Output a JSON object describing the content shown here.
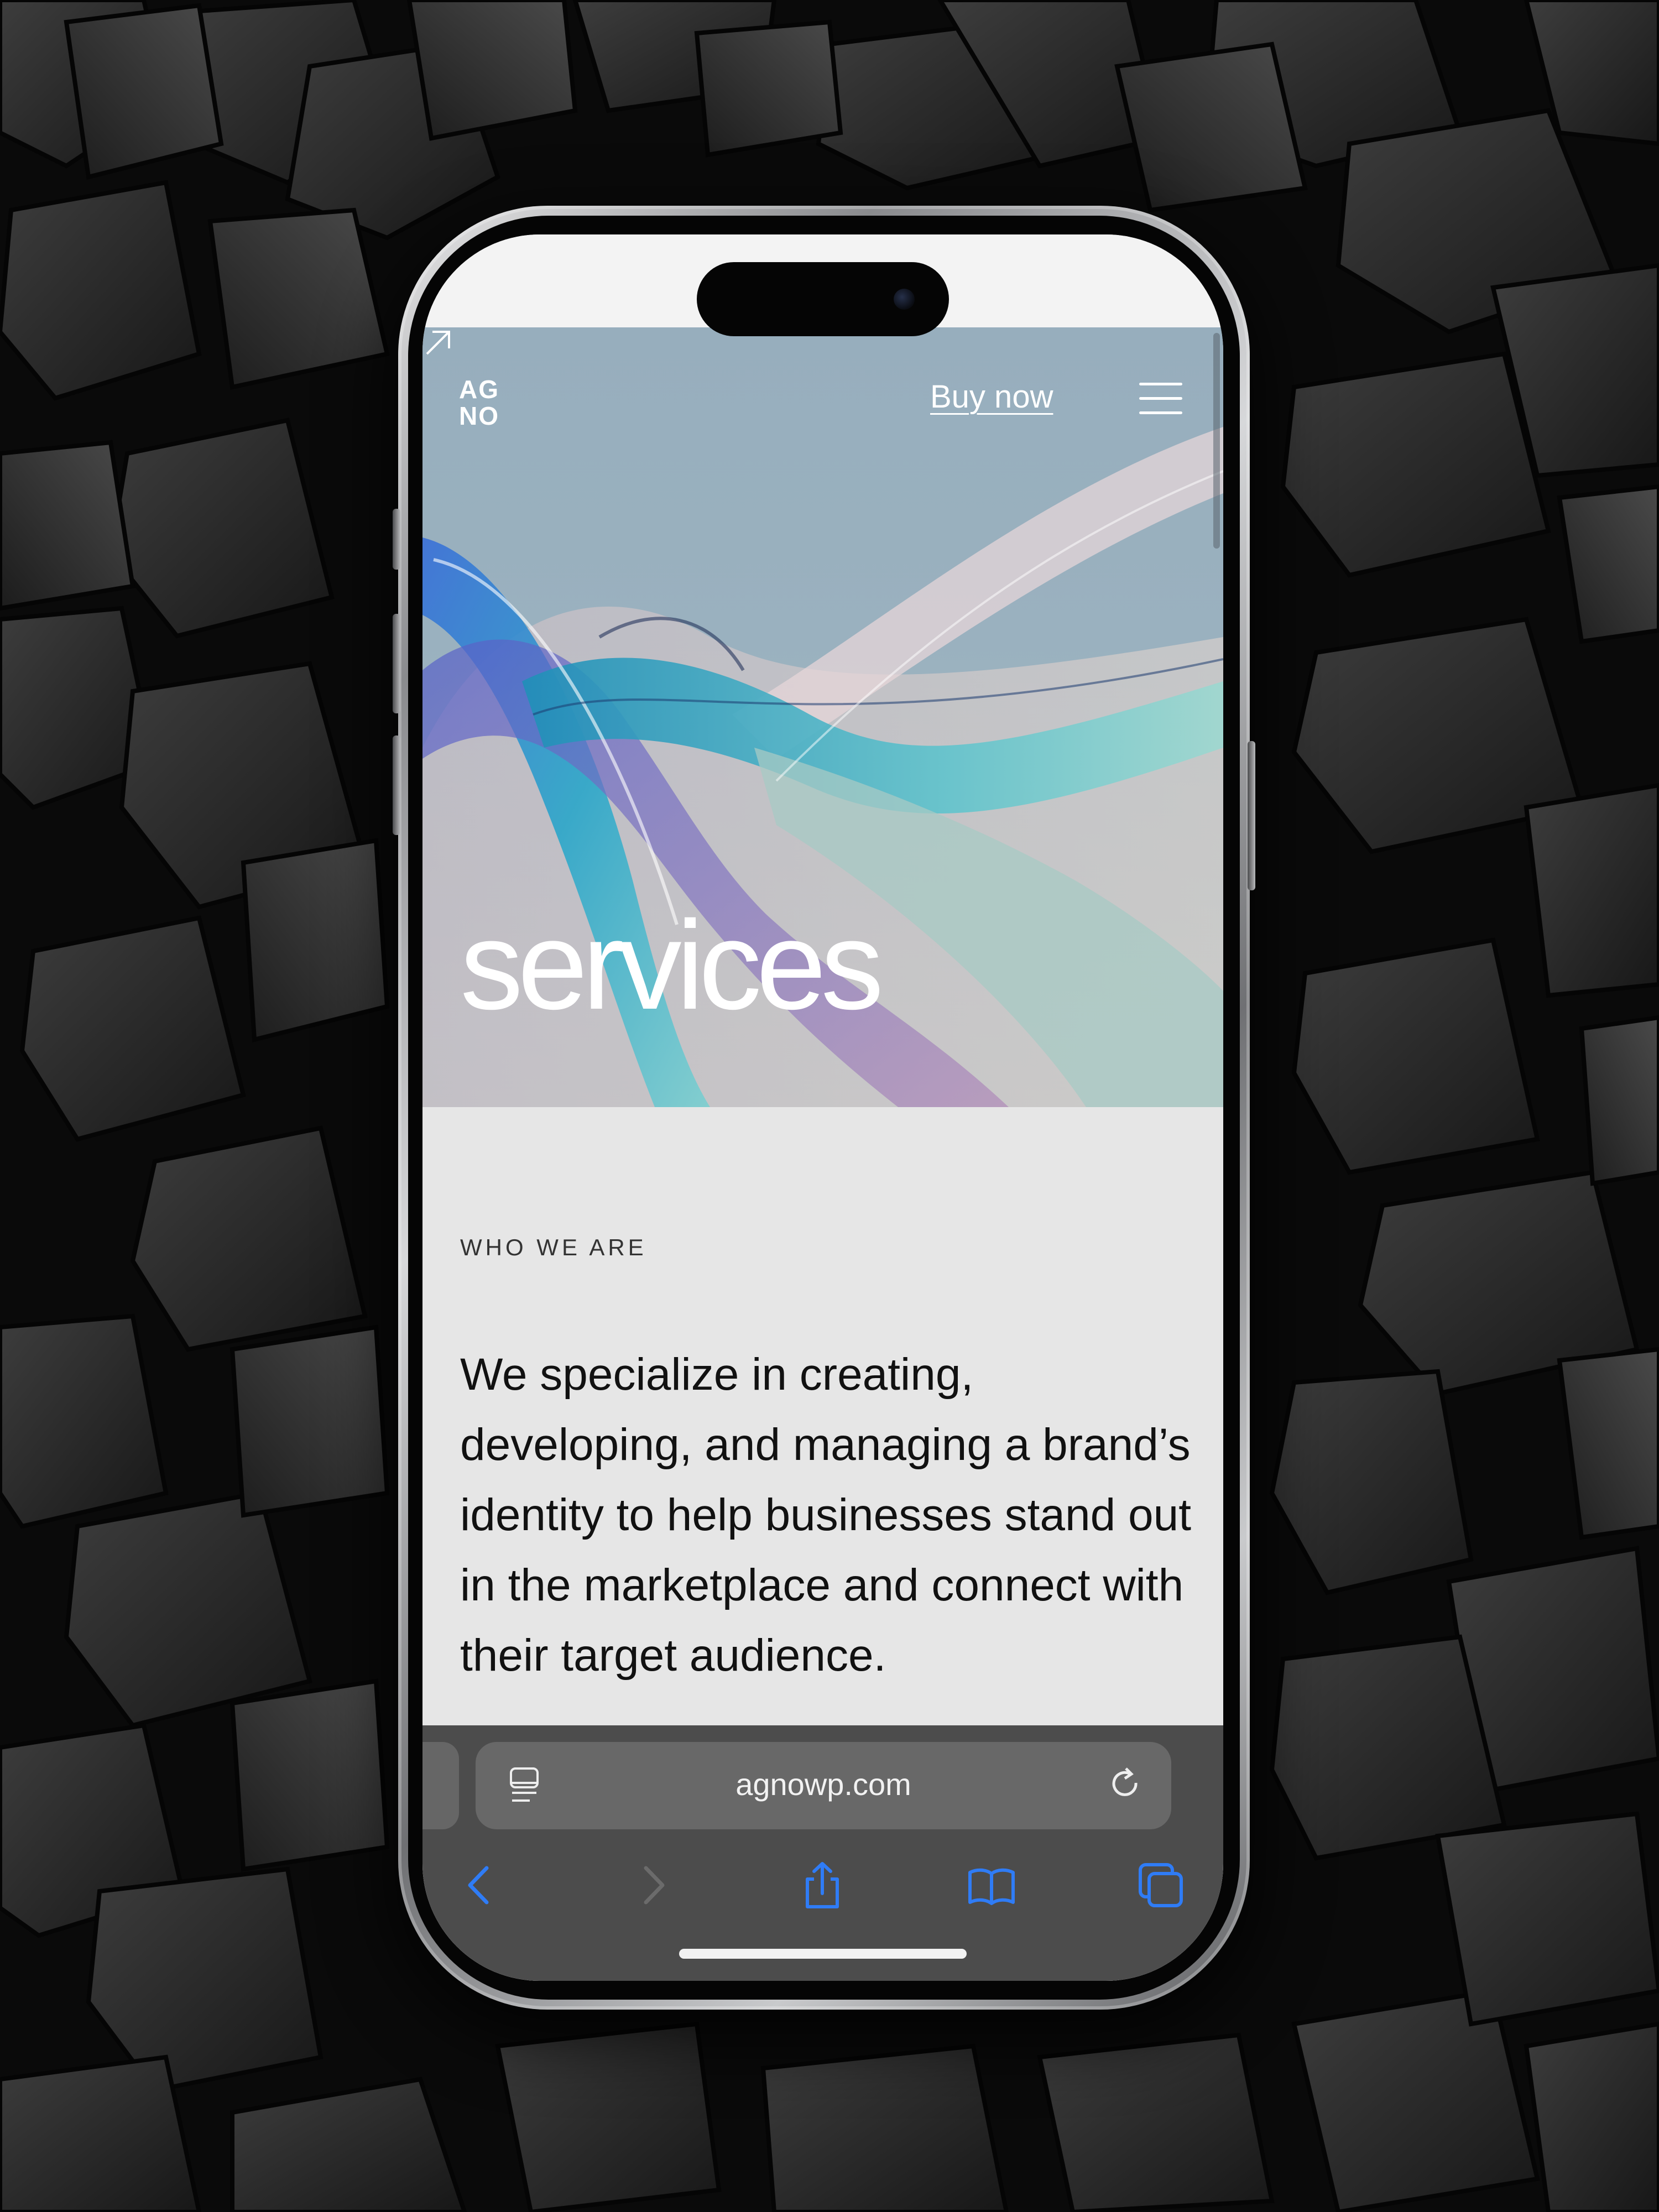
{
  "header": {
    "logo_line1": "AG",
    "logo_line2": "NO",
    "buy_now_label": "Buy now",
    "buy_now_icon": "arrow-up-right-icon",
    "menu_icon": "hamburger-menu-icon"
  },
  "hero": {
    "title": "services"
  },
  "content": {
    "eyebrow": "WHO WE ARE",
    "body": "We specialize in creating, developing, and managing a brand’s identity to help businesses stand out in the marketplace and connect with their target audience."
  },
  "browser": {
    "url": "agnowp.com",
    "page_icon": "page-settings-icon",
    "reload_icon": "reload-icon",
    "toolbar": [
      {
        "name": "back-icon",
        "enabled": true
      },
      {
        "name": "forward-icon",
        "enabled": false
      },
      {
        "name": "share-icon",
        "enabled": true
      },
      {
        "name": "bookmarks-icon",
        "enabled": true
      },
      {
        "name": "tabs-icon",
        "enabled": true
      }
    ],
    "accent_color": "#2f7cf6"
  },
  "colors": {
    "hero_sky": "#97aebd",
    "content_bg": "#e6e6e6",
    "browser_bar": "#4c4c4c"
  }
}
